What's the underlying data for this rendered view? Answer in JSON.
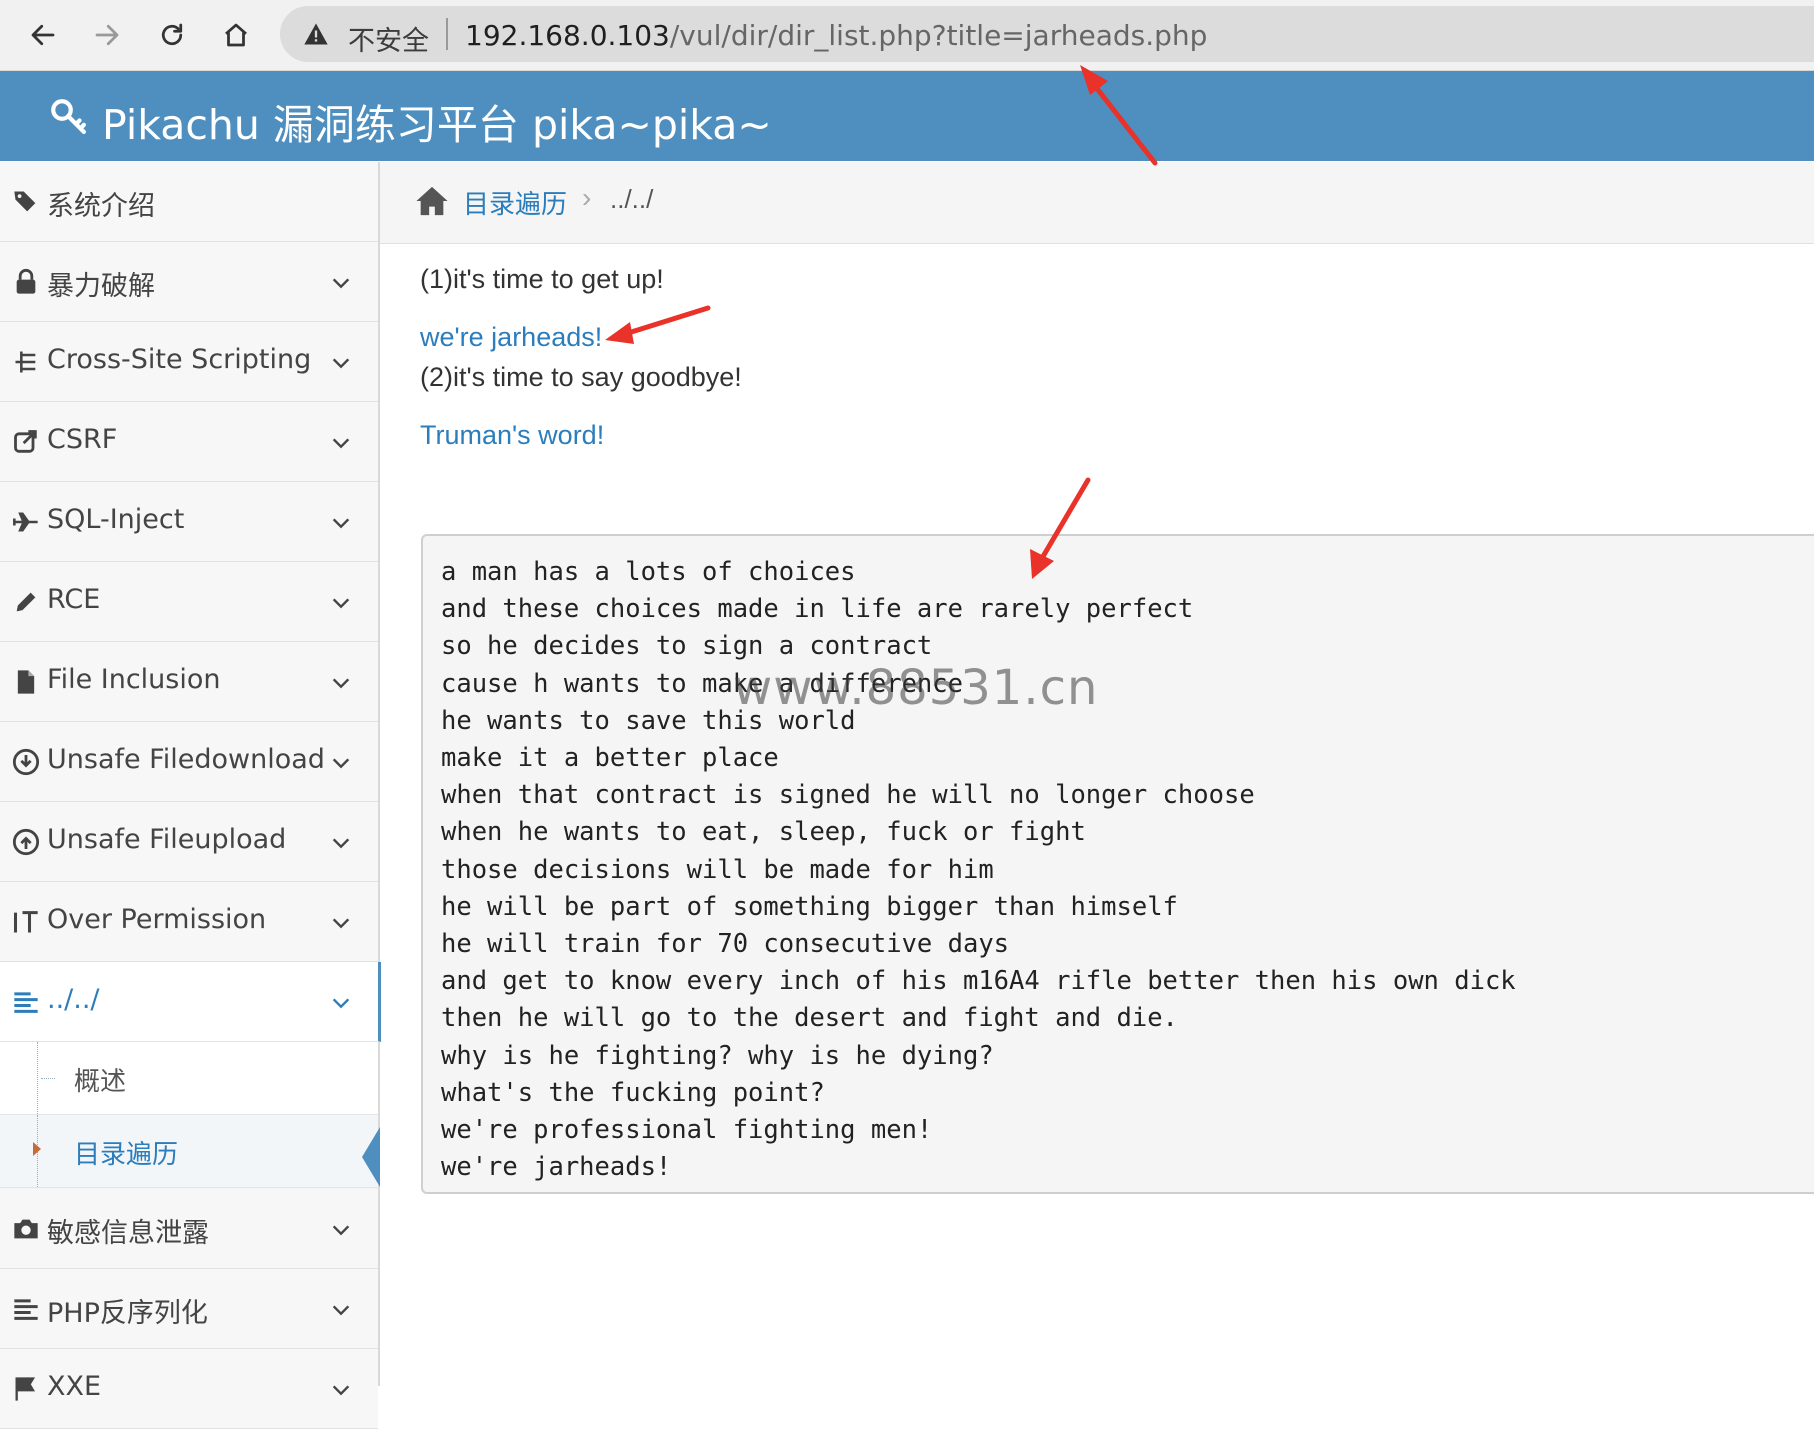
{
  "browser": {
    "insecure_label": "不安全",
    "url_host": "192.168.0.103",
    "url_path": "/vul/dir/dir_list.php?title=jarheads.php"
  },
  "header": {
    "title": "Pikachu 漏洞练习平台 pika~pika~"
  },
  "sidebar": {
    "items": [
      {
        "label": "系统介绍",
        "icon": "tags-icon"
      },
      {
        "label": "暴力破解",
        "icon": "lock-icon"
      },
      {
        "label": "Cross-Site Scripting",
        "icon": "list-tree-icon"
      },
      {
        "label": "CSRF",
        "icon": "share-icon"
      },
      {
        "label": "SQL-Inject",
        "icon": "plane-icon"
      },
      {
        "label": "RCE",
        "icon": "pencil-icon"
      },
      {
        "label": "File Inclusion",
        "icon": "file-icon"
      },
      {
        "label": "Unsafe Filedownload",
        "icon": "download-circle-icon"
      },
      {
        "label": "Unsafe Fileupload",
        "icon": "upload-circle-icon"
      },
      {
        "label": "Over Permission",
        "icon": "text-height-icon"
      },
      {
        "label": "../../",
        "icon": "align-left-icon"
      },
      {
        "label": "敏感信息泄露",
        "icon": "camera-icon"
      },
      {
        "label": "PHP反序列化",
        "icon": "align-left-icon"
      },
      {
        "label": "XXE",
        "icon": "flag-icon"
      }
    ],
    "subitems": [
      {
        "label": "概述"
      },
      {
        "label": "目录遍历"
      }
    ]
  },
  "breadcrumb": {
    "link": "目录遍历",
    "separator": "›",
    "current": "../../"
  },
  "content": {
    "line1": "(1)it's time to get up!",
    "link1": "we're jarheads!",
    "line2": "(2)it's time to say goodbye!",
    "link2": "Truman's word!",
    "poem": [
      "a man has a lots of choices",
      "and these choices made in life are rarely perfect",
      "so he decides to sign a contract",
      "cause h wants to make a difference",
      "he wants to save this world",
      "make it a better place",
      "when that contract is signed he will no longer choose",
      "when he wants to eat, sleep, fuck or fight",
      "those decisions will be made for him",
      "he will be part of something bigger than himself",
      "he will train for 70 consecutive days",
      "and get to know every inch of his m16A4 rifle better then his own dick",
      "then he will go to the desert and fight and die.",
      "why is he fighting? why is he dying?",
      "what's the fucking point?",
      "we're professional fighting men!",
      "we're jarheads!"
    ]
  },
  "watermark": "www.88531.cn",
  "colors": {
    "header": "#4e8fbf",
    "link": "#2b7dbc",
    "annotation_arrow": "#e8322a"
  }
}
